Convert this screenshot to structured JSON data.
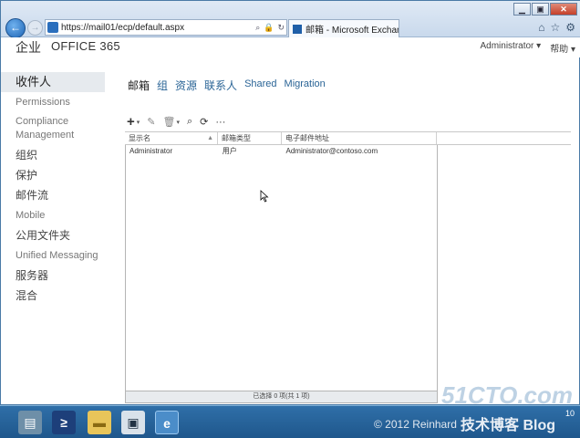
{
  "browser": {
    "url": "https://mail01/ecp/default.aspx",
    "tab_title": "邮箱 - Microsoft Exchange",
    "win_min": "▁",
    "win_max": "▣",
    "win_close": "✕",
    "search_icon": "⌕",
    "refresh_icon": "↻",
    "lock_icon": "🔒",
    "tools": [
      "⌂",
      "☆",
      "⚙"
    ]
  },
  "header": {
    "brand_a": "企业",
    "brand_b": "OFFICE 365",
    "user": "Administrator ▾",
    "help": "帮助 ▾"
  },
  "leftnav": {
    "items": [
      {
        "label": "收件人"
      },
      {
        "label": "Permissions"
      },
      {
        "label": "Compliance Management"
      },
      {
        "label": "组织"
      },
      {
        "label": "保护"
      },
      {
        "label": "邮件流"
      },
      {
        "label": "Mobile"
      },
      {
        "label": "公用文件夹"
      },
      {
        "label": "Unified Messaging"
      },
      {
        "label": "服务器"
      },
      {
        "label": "混合"
      }
    ]
  },
  "subtabs": [
    "邮箱",
    "组",
    "资源",
    "联系人",
    "Shared",
    "Migration"
  ],
  "toolbar": {
    "add": "+",
    "add_caret": "▾",
    "edit": "✎",
    "delete": "🗑",
    "delete_caret": "▾",
    "search": "⌕",
    "refresh": "⟳",
    "more": "···"
  },
  "grid": {
    "columns": [
      "显示名",
      "邮箱类型",
      "电子邮件地址"
    ],
    "sort_indicator": "▲",
    "rows": [
      {
        "name": "Administrator",
        "type": "用户",
        "email": "Administrator@contoso.com"
      }
    ],
    "footer": "已选择 0 项(共 1 项)"
  },
  "taskbar": {
    "server_icon": "▤",
    "ps_icon": "≥",
    "folder_icon": "▬",
    "app_icon": "▣",
    "ie_icon": "e"
  },
  "watermark": {
    "site": "51CTO.com",
    "blog": "技术博客",
    "copyright": "© 2012 Reinhard",
    "blog_en": "Blog",
    "tray_time": "10"
  }
}
